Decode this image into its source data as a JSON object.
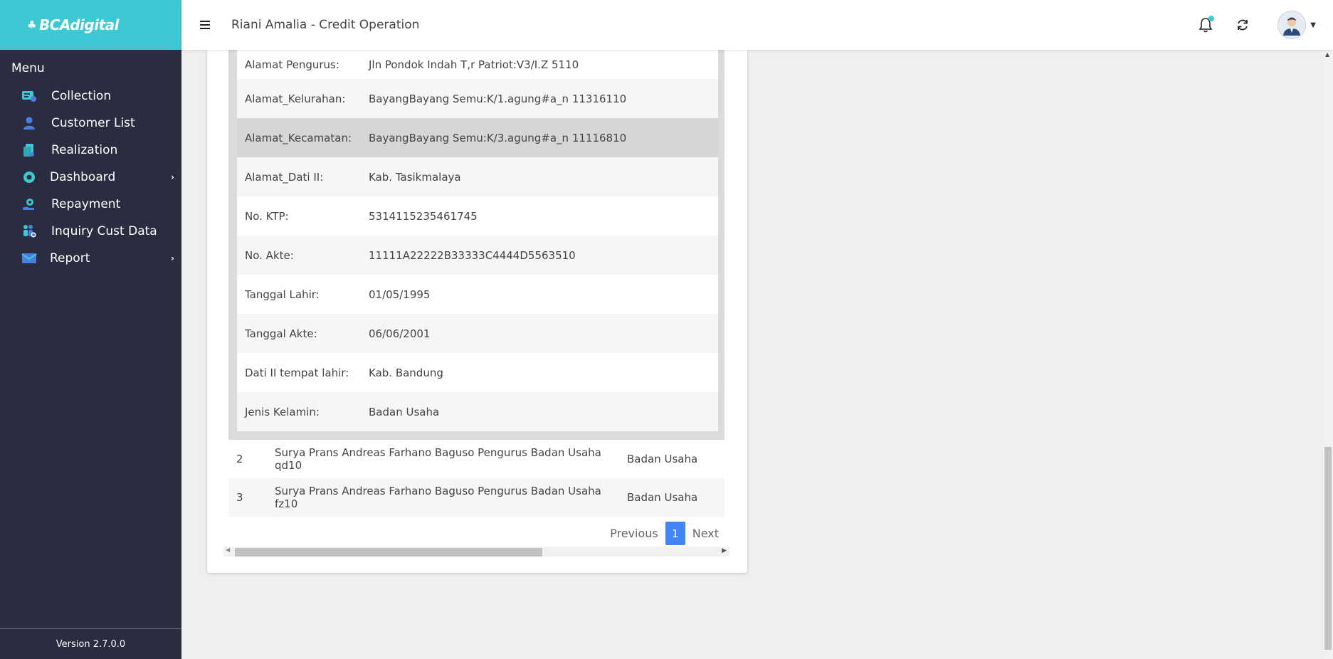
{
  "brand": {
    "name": "BCAdigital"
  },
  "sidebar": {
    "menu_title": "Menu",
    "items": [
      {
        "label": "Collection",
        "icon": "collection-icon",
        "has_arrow": false
      },
      {
        "label": "Customer List",
        "icon": "user-icon",
        "has_arrow": false
      },
      {
        "label": "Realization",
        "icon": "document-icon",
        "has_arrow": false
      },
      {
        "label": "Dashboard",
        "icon": "dashboard-icon",
        "has_arrow": true
      },
      {
        "label": "Repayment",
        "icon": "repayment-icon",
        "has_arrow": false
      },
      {
        "label": "Inquiry Cust Data",
        "icon": "users-group-icon",
        "has_arrow": false
      },
      {
        "label": "Report",
        "icon": "mail-icon",
        "has_arrow": true
      }
    ],
    "version": "Version 2.7.0.0"
  },
  "header": {
    "title": "Riani Amalia - Credit Operation"
  },
  "detail": {
    "rows": [
      {
        "key": "Alamat Pengurus:",
        "value": "Jln Pondok Indah T,r Patriot:V3/I.Z 5110"
      },
      {
        "key": "Alamat_Kelurahan:",
        "value": "BayangBayang Semu:K/1.agung#a_n 11316110"
      },
      {
        "key": "Alamat_Kecamatan:",
        "value": "BayangBayang Semu:K/3.agung#a_n 11116810"
      },
      {
        "key": "Alamat_Dati II:",
        "value": "Kab. Tasikmalaya"
      },
      {
        "key": "No. KTP:",
        "value": "5314115235461745"
      },
      {
        "key": "No. Akte:",
        "value": "11111A22222B33333C4444D5563510"
      },
      {
        "key": "Tanggal Lahir:",
        "value": "01/05/1995"
      },
      {
        "key": "Tanggal Akte:",
        "value": "06/06/2001"
      },
      {
        "key": "Dati II tempat lahir:",
        "value": "Kab. Bandung"
      },
      {
        "key": "Jenis Kelamin:",
        "value": "Badan Usaha"
      }
    ]
  },
  "list": {
    "rows": [
      {
        "no": "2",
        "name": "Surya Prans Andreas Farhano Baguso Pengurus Badan Usaha qd10",
        "type": "Badan Usaha"
      },
      {
        "no": "3",
        "name": "Surya Prans Andreas Farhano Baguso Pengurus Badan Usaha fz10",
        "type": "Badan Usaha"
      }
    ]
  },
  "pagination": {
    "previous": "Previous",
    "current": "1",
    "next": "Next"
  },
  "colors": {
    "brand": "#3cc9d4",
    "sidebar_bg": "#292d3f",
    "page_active": "#4285f4"
  }
}
